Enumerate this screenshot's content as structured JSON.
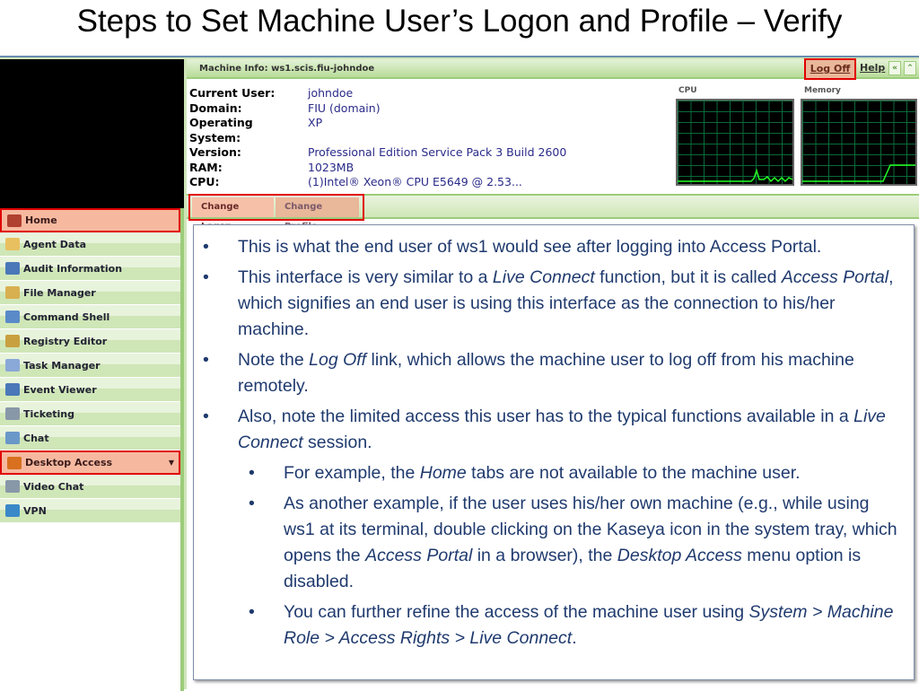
{
  "slide_title": "Steps to Set Machine User’s Logon and Profile – Verify",
  "header": {
    "machine_info": "Machine Info: ws1.scis.fiu-johndoe",
    "log_off": "Log Off",
    "help": "Help",
    "collapse": "«",
    "up": "⌃"
  },
  "info": [
    {
      "k": "Current User:",
      "v": "johndoe"
    },
    {
      "k": "Domain:",
      "v": "FIU (domain)"
    },
    {
      "k": "Operating System:",
      "v": "XP"
    },
    {
      "k": "Version:",
      "v": "Professional Edition Service Pack 3 Build 2600"
    },
    {
      "k": "RAM:",
      "v": "1023MB"
    },
    {
      "k": "CPU:",
      "v": "(1)Intel® Xeon® CPU E5649 @ 2.53..."
    }
  ],
  "graphs": {
    "cpu": "CPU",
    "memory": "Memory"
  },
  "tabs": [
    "Change Logon",
    "Change Profile"
  ],
  "sidebar": [
    {
      "label": "Home",
      "color": "#b04030"
    },
    {
      "label": "Agent Data",
      "color": "#e8c060"
    },
    {
      "label": "Audit Information",
      "color": "#4a78b8"
    },
    {
      "label": "File Manager",
      "color": "#d8b050"
    },
    {
      "label": "Command Shell",
      "color": "#5a8ac8"
    },
    {
      "label": "Registry Editor",
      "color": "#c8a040"
    },
    {
      "label": "Task Manager",
      "color": "#8aa8d8"
    },
    {
      "label": "Event Viewer",
      "color": "#4a78b8"
    },
    {
      "label": "Ticketing",
      "color": "#8898a8"
    },
    {
      "label": "Chat",
      "color": "#6a98c8"
    },
    {
      "label": "Desktop Access",
      "color": "#d87020"
    },
    {
      "label": "Video Chat",
      "color": "#8898a8"
    },
    {
      "label": "VPN",
      "color": "#3a88c8"
    }
  ],
  "bullets": [
    {
      "html": "This is what the end user of ws1 would see after logging into Access Portal."
    },
    {
      "html": "This interface is very similar to a <i>Live Connect</i> function, but it is called <i>Access Portal</i>, which signifies an end user is using this interface as the connection to his/her machine."
    },
    {
      "html": "Note the <i>Log Off</i> link, which allows the machine user to log off from his machine remotely."
    },
    {
      "html": "Also, note the limited access this user has to the typical functions available in a <i>Live Connect</i> session."
    },
    {
      "sub": true,
      "html": "For example, the <i>Home</i> tabs are not available to the machine user."
    },
    {
      "sub": true,
      "html": "As another example, if the user uses his/her own machine (e.g., while using ws1 at its terminal, double clicking on the Kaseya icon in the system tray, which opens the  <i>Access Portal</i> in a browser), the <i>Desktop Access</i> menu option is disabled."
    },
    {
      "sub": true,
      "html": "You can further refine the access of the machine user using <i>System &gt; Machine Role &gt; Access Rights &gt; Live Connect</i>."
    }
  ]
}
